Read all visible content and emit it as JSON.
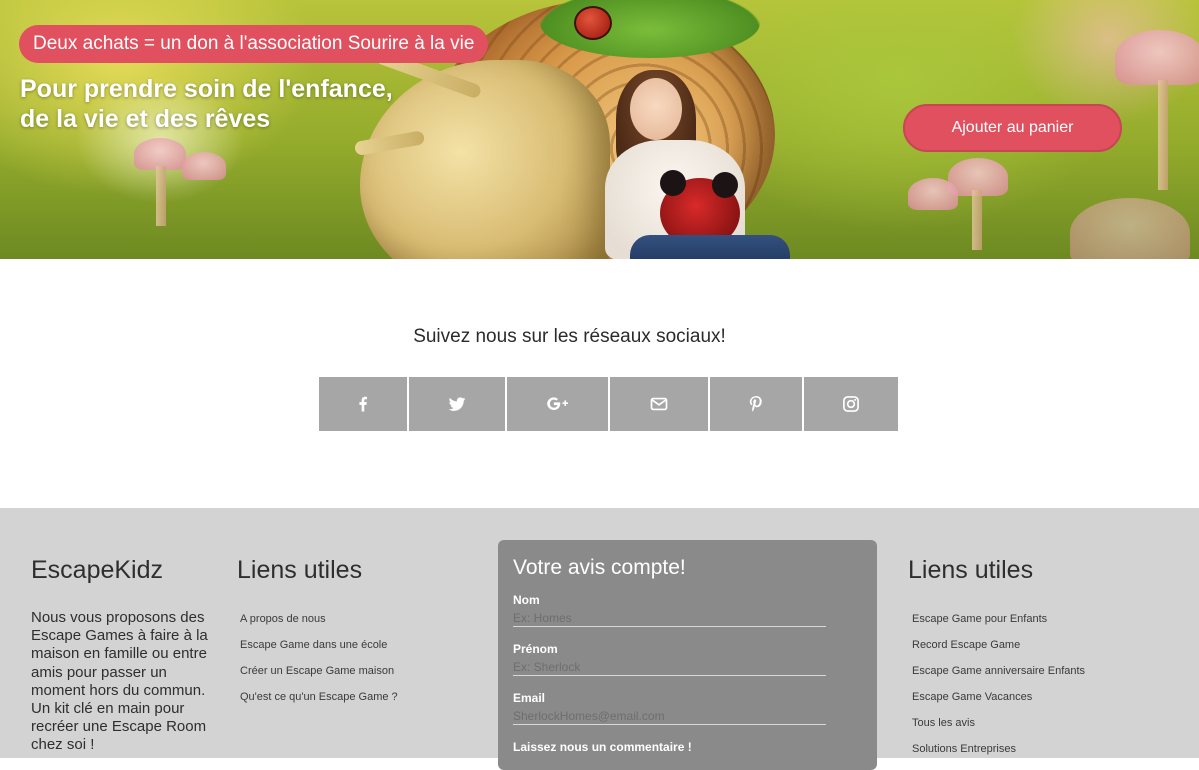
{
  "hero": {
    "promo": "Deux achats = un don à l'association Sourire à la vie",
    "title_line1": "Pour prendre soin de l'enfance,",
    "title_line2": "de la vie et des rêves",
    "cart_button": "Ajouter au panier",
    "accent_color": "#e0505f"
  },
  "social": {
    "title": "Suivez nous sur les réseaux sociaux!",
    "buttons": [
      {
        "icon": "facebook-icon"
      },
      {
        "icon": "twitter-icon"
      },
      {
        "icon": "google-plus-icon"
      },
      {
        "icon": "mail-icon"
      },
      {
        "icon": "pinterest-icon"
      },
      {
        "icon": "instagram-icon"
      }
    ]
  },
  "footer": {
    "brand": {
      "title": "EscapeKidz",
      "description": "Nous vous proposons des Escape Games à faire à la maison en famille ou entre amis pour passer un moment hors du commun. Un kit clé en main pour recréer une Escape Room chez soi !"
    },
    "links_left": {
      "title": "Liens utiles",
      "items": [
        "A propos de nous",
        "Escape Game dans une école",
        "Créer un Escape Game maison",
        "Qu'est ce qu'un Escape Game ?"
      ]
    },
    "feedback": {
      "title": "Votre avis compte!",
      "name_label": "Nom",
      "name_placeholder": "Ex: Homes",
      "firstname_label": "Prénom",
      "firstname_placeholder": "Ex: Sherlock",
      "email_label": "Email",
      "email_placeholder": "SherlockHomes@email.com",
      "comment_label": "Laissez nous un commentaire !"
    },
    "links_right": {
      "title": "Liens utiles",
      "items": [
        "Escape Game pour Enfants",
        "Record Escape Game",
        "Escape Game anniversaire Enfants",
        "Escape Game Vacances",
        "Tous les avis",
        "Solutions Entreprises"
      ]
    }
  }
}
